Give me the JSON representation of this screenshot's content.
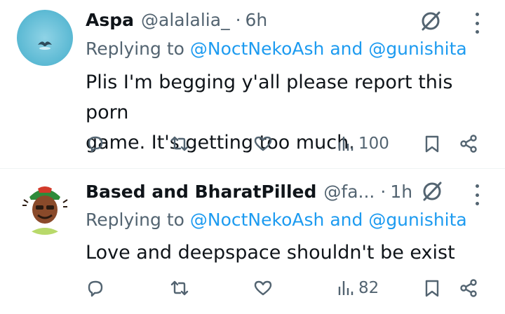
{
  "tweets": [
    {
      "name": "Aspa",
      "handle": "@alalalia_",
      "dot": "·",
      "time": "6h",
      "replying_prefix": "Replying to ",
      "reply_mention_1": "@NoctNekoAsh",
      "reply_and": " and ",
      "reply_mention_2": "@gunishita",
      "text_line_1": "Plis I'm begging y'all please report this porn",
      "text_line_2": "game. It's getting too much.",
      "views": "100",
      "avatar_icon": "whale-tail-ocean-avatar"
    },
    {
      "name": "Based and BharatPilled",
      "handle": "@fa...",
      "dot": "·",
      "time": "1h",
      "replying_prefix": "Replying to ",
      "reply_mention_1": "@NoctNekoAsh",
      "reply_and": " and ",
      "reply_mention_2": "@gunishita",
      "text_line_1": "Love and deepspace shouldn't be exist",
      "views": "82",
      "avatar_icon": "cartoon-man-turban-avatar"
    }
  ],
  "icons": {
    "reply": "reply-icon",
    "retweet": "retweet-icon",
    "like": "like-icon",
    "views": "views-icon",
    "bookmark": "bookmark-icon",
    "share": "share-icon",
    "grok": "grok-icon",
    "more": "more-icon"
  },
  "colors": {
    "text": "#0f1419",
    "secondary": "#536471",
    "link": "#1d9bf0",
    "divider": "#eff3f4"
  }
}
